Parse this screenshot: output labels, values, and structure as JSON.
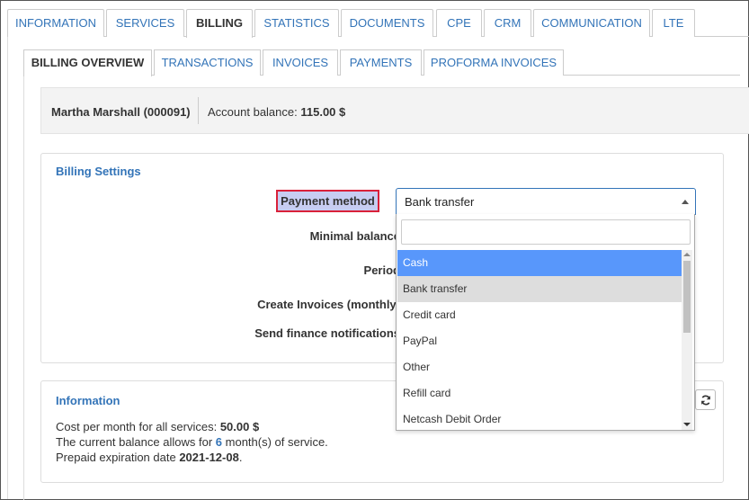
{
  "top_tabs": [
    {
      "label": "INFORMATION"
    },
    {
      "label": "SERVICES"
    },
    {
      "label": "BILLING"
    },
    {
      "label": "STATISTICS"
    },
    {
      "label": "DOCUMENTS"
    },
    {
      "label": "CPE"
    },
    {
      "label": "CRM"
    },
    {
      "label": "COMMUNICATION"
    },
    {
      "label": "LTE"
    }
  ],
  "sub_tabs": [
    {
      "label": "BILLING OVERVIEW"
    },
    {
      "label": "TRANSACTIONS"
    },
    {
      "label": "INVOICES"
    },
    {
      "label": "PAYMENTS"
    },
    {
      "label": "PROFORMA INVOICES"
    }
  ],
  "account": {
    "name": "Martha Marshall (000091)",
    "balance_label": "Account balance:",
    "balance_value": "115.00 $"
  },
  "billing_settings": {
    "title": "Billing Settings",
    "payment_method_label": "Payment method",
    "minimal_balance_label": "Minimal balance",
    "period_label": "Period",
    "create_invoices_label": "Create Invoices (monthly)",
    "send_notifications_label": "Send finance notifications",
    "payment_method_value": "Bank transfer",
    "search_value": "",
    "options": [
      {
        "label": "Cash"
      },
      {
        "label": "Bank transfer"
      },
      {
        "label": "Credit card"
      },
      {
        "label": "PayPal"
      },
      {
        "label": "Other"
      },
      {
        "label": "Refill card"
      },
      {
        "label": "Netcash Debit Order"
      }
    ]
  },
  "information": {
    "title": "Information",
    "cost_label": "Cost per month for all services:",
    "cost_value": "50.00 $",
    "balance_allows_prefix": "The current balance allows for",
    "balance_allows_months": "6",
    "balance_allows_suffix": "month(s) of service.",
    "prepaid_label": "Prepaid expiration date",
    "prepaid_value": "2021-12-08",
    "prepaid_suffix": "."
  },
  "icons": {
    "refresh": "refresh-icon"
  },
  "colors": {
    "link": "#3374b8",
    "highlight": "#5897fb",
    "label_highlight_bg": "#c7cdf2",
    "label_highlight_border": "#d9213a"
  }
}
